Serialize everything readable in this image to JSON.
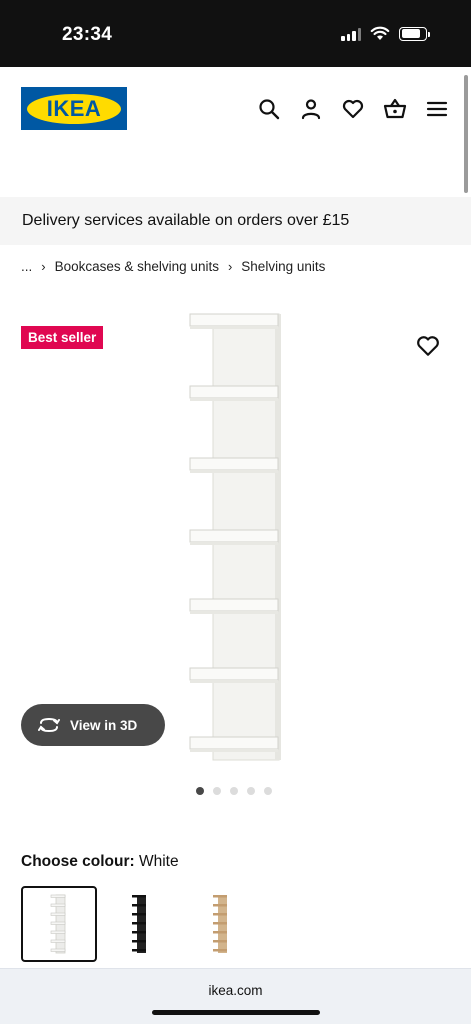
{
  "status_bar": {
    "time": "23:34"
  },
  "header": {
    "logo_text": "IKEA",
    "icons": [
      "search-icon",
      "user-icon",
      "heart-icon",
      "basket-icon",
      "menu-icon"
    ]
  },
  "banner": {
    "text": "Delivery services available on orders over £15"
  },
  "breadcrumb": {
    "items": [
      "...",
      "Bookcases & shelving units",
      "Shelving units"
    ]
  },
  "product": {
    "badge": "Best seller",
    "view_3d_label": "View in 3D",
    "image_count": 5,
    "active_image": 1
  },
  "colour": {
    "label": "Choose colour:",
    "value": "White",
    "options": [
      {
        "name": "white",
        "color": "#eeeeea"
      },
      {
        "name": "black",
        "color": "#222222"
      },
      {
        "name": "oak",
        "color": "#c8a77e"
      }
    ]
  },
  "browser": {
    "url": "ikea.com"
  },
  "colors": {
    "brand_blue": "#0058a3",
    "brand_yellow": "#ffdb00",
    "badge": "#e00751"
  }
}
